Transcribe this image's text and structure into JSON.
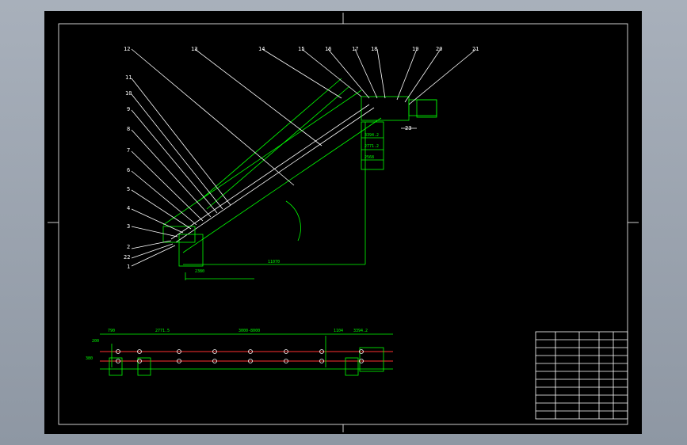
{
  "drawing": {
    "part_numbers": [
      "12",
      "13",
      "14",
      "15",
      "16",
      "17",
      "18",
      "19",
      "20",
      "21",
      "11",
      "10",
      "9",
      "8",
      "7",
      "6",
      "5",
      "4",
      "3",
      "2",
      "22",
      "1",
      "23"
    ],
    "dims_bottom": [
      "11070",
      "2380"
    ],
    "dims_misc": [
      "280",
      "4x",
      "2771.2",
      "2568",
      "3394.2",
      "5960"
    ],
    "bottom_labels": [
      "3000-8000",
      "2771.5",
      "1104",
      "3394.2",
      "380",
      "790",
      "200"
    ],
    "colors": {
      "sheet": "#000000",
      "frame": "#ffffff",
      "lines": "#00ff00",
      "section": "#ff3030"
    }
  }
}
